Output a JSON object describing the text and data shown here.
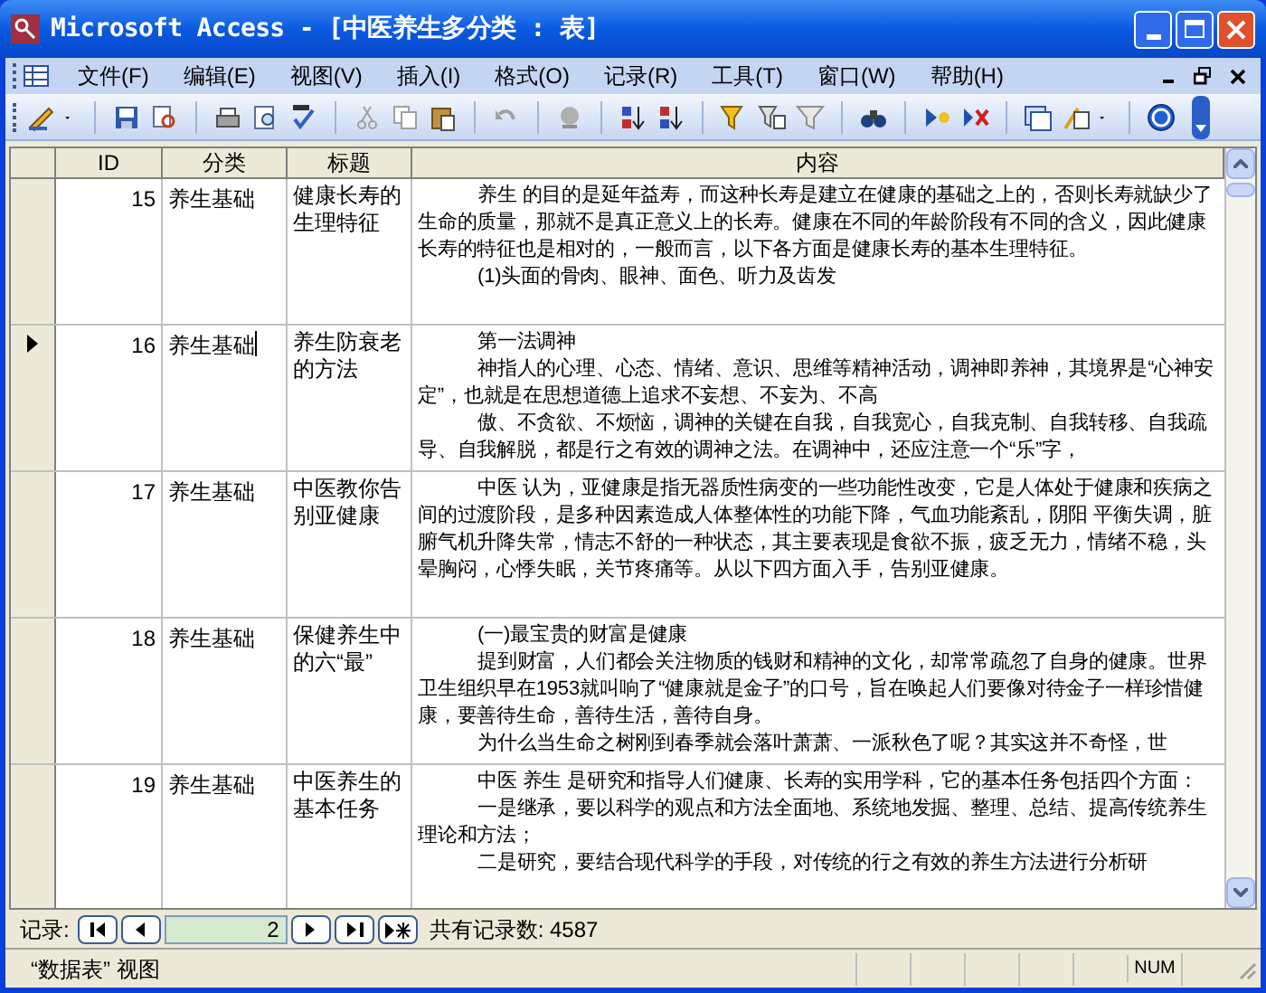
{
  "window": {
    "title": "Microsoft Access - [中医养生多分类 : 表]"
  },
  "menu": [
    "文件(F)",
    "编辑(E)",
    "视图(V)",
    "插入(I)",
    "格式(O)",
    "记录(R)",
    "工具(T)",
    "窗口(W)",
    "帮助(H)"
  ],
  "table": {
    "columns": [
      "ID",
      "分类",
      "标题",
      "内容"
    ],
    "rows": [
      {
        "id": "15",
        "category": "养生基础",
        "title": "健康长寿的生理特征",
        "current": false,
        "editing": false,
        "content": [
          "养生 的目的是延年益寿，而这种长寿是建立在健康的基础之上的，否则长寿就缺少了生命的质量，那就不是真正意义上的长寿。健康在不同的年龄阶段有不同的含义，因此健康长寿的特征也是相对的，一般而言，以下各方面是健康长寿的基本生理特征。",
          "(1)头面的骨肉、眼神、面色、听力及齿发"
        ]
      },
      {
        "id": "16",
        "category": "养生基础",
        "title": "养生防衰老的方法",
        "current": true,
        "editing": true,
        "content": [
          "第一法调神",
          "神指人的心理、心态、情绪、意识、思维等精神活动，调神即养神，其境界是“心神安定”，也就是在思想道德上追求不妄想、不妄为、不高",
          "傲、不贪欲、不烦恼，调神的关键在自我，自我宽心，自我克制、自我转移、自我疏导、自我解脱，都是行之有效的调神之法。在调神中，还应注意一个“乐”字，"
        ]
      },
      {
        "id": "17",
        "category": "养生基础",
        "title": "中医教你告别亚健康",
        "current": false,
        "editing": false,
        "content": [
          "中医 认为，亚健康是指无器质性病变的一些功能性改变，它是人体处于健康和疾病之间的过渡阶段，是多种因素造成人体整体性的功能下降，气血功能紊乱，阴阳 平衡失调，脏腑气机升降失常，情志不舒的一种状态，其主要表现是食欲不振，疲乏无力，情绪不稳，头晕胸闷，心悸失眠，关节疼痛等。从以下四方面入手，告别亚健康。"
        ]
      },
      {
        "id": "18",
        "category": "养生基础",
        "title": "保健养生中的六“最”",
        "current": false,
        "editing": false,
        "content": [
          "(一)最宝贵的财富是健康",
          "提到财富，人们都会关注物质的钱财和精神的文化，却常常疏忽了自身的健康。世界卫生组织早在1953就叫响了“健康就是金子”的口号，旨在唤起人们要像对待金子一样珍惜健康，要善待生命，善待生活，善待自身。",
          "为什么当生命之树刚到春季就会落叶萧萧、一派秋色了呢？其实这并不奇怪，世"
        ]
      },
      {
        "id": "19",
        "category": "养生基础",
        "title": "中医养生的基本任务",
        "current": false,
        "editing": false,
        "content": [
          "中医 养生 是研究和指导人们健康、长寿的实用学科，它的基本任务包括四个方面：",
          "一是继承，要以科学的观点和方法全面地、系统地发掘、整理、总结、提高传统养生理论和方法；",
          "二是研究，要结合现代科学的手段，对传统的行之有效的养生方法进行分析研"
        ]
      }
    ]
  },
  "navigator": {
    "label": "记录:",
    "current": "2",
    "count": "共有记录数: 4587"
  },
  "status_bar": {
    "view": "“数据表” 视图",
    "num": "NUM"
  }
}
